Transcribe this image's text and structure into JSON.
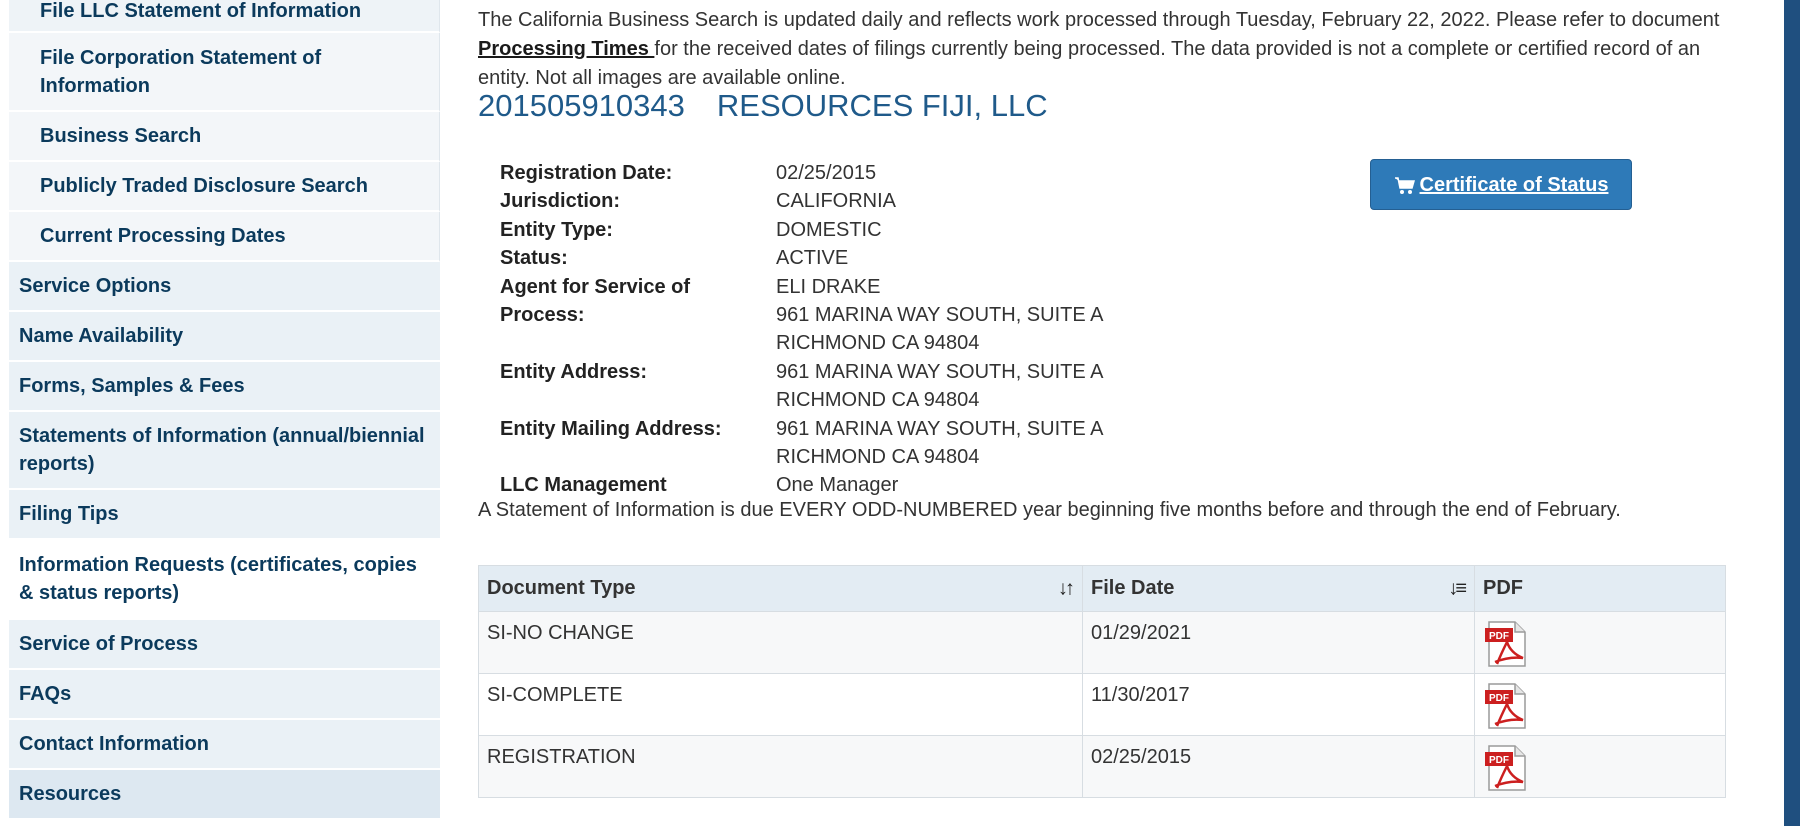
{
  "sidebar": {
    "sub_items": [
      {
        "label": "File LLC Statement of Information"
      },
      {
        "label": "File Corporation Statement of Information"
      },
      {
        "label": "Business Search"
      },
      {
        "label": "Publicly Traded Disclosure Search"
      },
      {
        "label": "Current Processing Dates"
      }
    ],
    "top_items": [
      {
        "label": "Service Options"
      },
      {
        "label": "Name Availability"
      },
      {
        "label": "Forms, Samples & Fees"
      },
      {
        "label": "Statements of Information (annual/biennial reports)"
      },
      {
        "label": "Filing Tips"
      },
      {
        "label": "Information Requests (certificates, copies & status reports)"
      },
      {
        "label": "Service of Process"
      },
      {
        "label": "FAQs"
      },
      {
        "label": "Contact Information"
      },
      {
        "label": "Resources"
      }
    ]
  },
  "intro": {
    "text_before": "The California Business Search is updated daily and reflects work processed through Tuesday, February 22, 2022. Please refer to document ",
    "link": "Processing Times ",
    "text_after": "for the received dates of filings currently being processed. The data provided is not a complete or certified record of an entity. Not all images are available online."
  },
  "entity": {
    "number": "201505910343",
    "name": "RESOURCES FIJI, LLC"
  },
  "details": {
    "registration_date": {
      "label": "Registration Date:",
      "value": "02/25/2015"
    },
    "jurisdiction": {
      "label": "Jurisdiction:",
      "value": "CALIFORNIA"
    },
    "entity_type": {
      "label": "Entity Type:",
      "value": "DOMESTIC"
    },
    "status": {
      "label": "Status:",
      "value": "ACTIVE"
    },
    "agent": {
      "label_line1": "Agent for Service of",
      "label_line2": "Process:",
      "line1": "ELI DRAKE",
      "line2": "961 MARINA WAY SOUTH, SUITE A",
      "line3": "RICHMOND CA 94804"
    },
    "entity_address": {
      "label": "Entity Address:",
      "line1": "961 MARINA WAY SOUTH, SUITE A",
      "line2": "RICHMOND CA 94804"
    },
    "mailing_address": {
      "label": "Entity Mailing Address:",
      "line1": "961 MARINA WAY SOUTH, SUITE A",
      "line2": "RICHMOND CA 94804"
    },
    "llc_management": {
      "label": "LLC Management",
      "value": "One Manager"
    }
  },
  "certificate_button": {
    "label": "Certificate of Status",
    "icon": "cart-icon"
  },
  "soi_note": "A Statement of Information is due EVERY ODD-NUMBERED year beginning five months before and through the end of February.",
  "documents": {
    "columns": [
      "Document Type",
      "File Date",
      "PDF"
    ],
    "rows": [
      {
        "type": "SI-NO CHANGE",
        "date": "01/29/2021",
        "icon": "pdf-icon"
      },
      {
        "type": "SI-COMPLETE",
        "date": "11/30/2017",
        "icon": "pdf-icon"
      },
      {
        "type": "REGISTRATION",
        "date": "02/25/2015",
        "icon": "pdf-icon"
      }
    ]
  },
  "colors": {
    "link_blue": "#1f5a8a",
    "nav_text": "#0b3a5c",
    "button_blue": "#2e7ab8",
    "right_edge": "#1f4f7f"
  }
}
